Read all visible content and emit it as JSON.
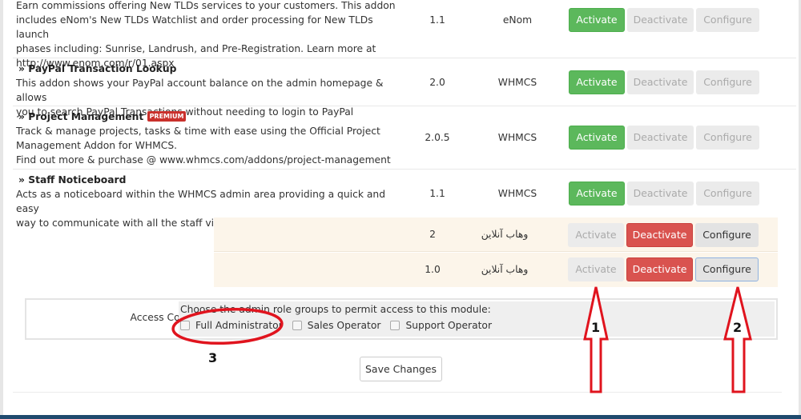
{
  "addons": [
    {
      "title": "",
      "badge": "",
      "description_lines": [
        "Earn commissions offering New TLDs services to your customers. This addon",
        "includes eNom's New TLDs Watchlist and order processing for New TLDs launch",
        "phases including: Sunrise, Landrush, and Pre-Registration. Learn more at",
        "http://www.enom.com/r/01.aspx"
      ],
      "version": "1.1",
      "author": "eNom",
      "activate": "Activate",
      "deactivate": "Deactivate",
      "configure": "Configure",
      "status": "inactive"
    },
    {
      "title": "» PayPal Transaction Lookup",
      "badge": "",
      "description_lines": [
        "This addon shows your PayPal account balance on the admin homepage & allows",
        "you to search PayPal Transactions without needing to login to PayPal"
      ],
      "version": "2.0",
      "author": "WHMCS",
      "activate": "Activate",
      "deactivate": "Deactivate",
      "configure": "Configure",
      "status": "inactive"
    },
    {
      "title": "» Project Management",
      "badge": "PREMIUM",
      "description_lines": [
        "Track & manage projects, tasks & time with ease using the Official Project",
        "Management Addon for WHMCS.",
        "Find out more & purchase @ www.whmcs.com/addons/project-management"
      ],
      "version": "2.0.5",
      "author": "WHMCS",
      "activate": "Activate",
      "deactivate": "Deactivate",
      "configure": "Configure",
      "status": "inactive"
    },
    {
      "title": "» Staff Noticeboard",
      "badge": "",
      "description_lines": [
        "Acts as a noticeboard within the WHMCS admin area providing a quick and easy",
        "way to communicate with all the staff via your WHMCS system"
      ],
      "version": "1.1",
      "author": "WHMCS",
      "activate": "Activate",
      "deactivate": "Deactivate",
      "configure": "Configure",
      "status": "inactive"
    },
    {
      "title": "",
      "badge": "",
      "description_lines": [],
      "version": "2",
      "author": "وهاب آنلاین",
      "activate": "Activate",
      "deactivate": "Deactivate",
      "configure": "Configure",
      "status": "active"
    },
    {
      "title": "",
      "badge": "",
      "description_lines": [],
      "version": "1.0",
      "author": "وهاب آنلاین",
      "activate": "Activate",
      "deactivate": "Deactivate",
      "configure": "Configure",
      "status": "active"
    }
  ],
  "access_control": {
    "label": "Access Control",
    "hint": "Choose the admin role groups to permit access to this module:",
    "roles": [
      {
        "label": "Full Administrator",
        "checked": false
      },
      {
        "label": "Sales Operator",
        "checked": false
      },
      {
        "label": "Support Operator",
        "checked": false
      }
    ]
  },
  "save_label": "Save Changes",
  "annotations": {
    "one": "1",
    "two": "2",
    "three": "3"
  },
  "colors": {
    "activate_green": "#5cb85c",
    "deactivate_red": "#d9534f",
    "active_row_bg": "#fcf5ea",
    "annotation_red": "#e0141e"
  }
}
